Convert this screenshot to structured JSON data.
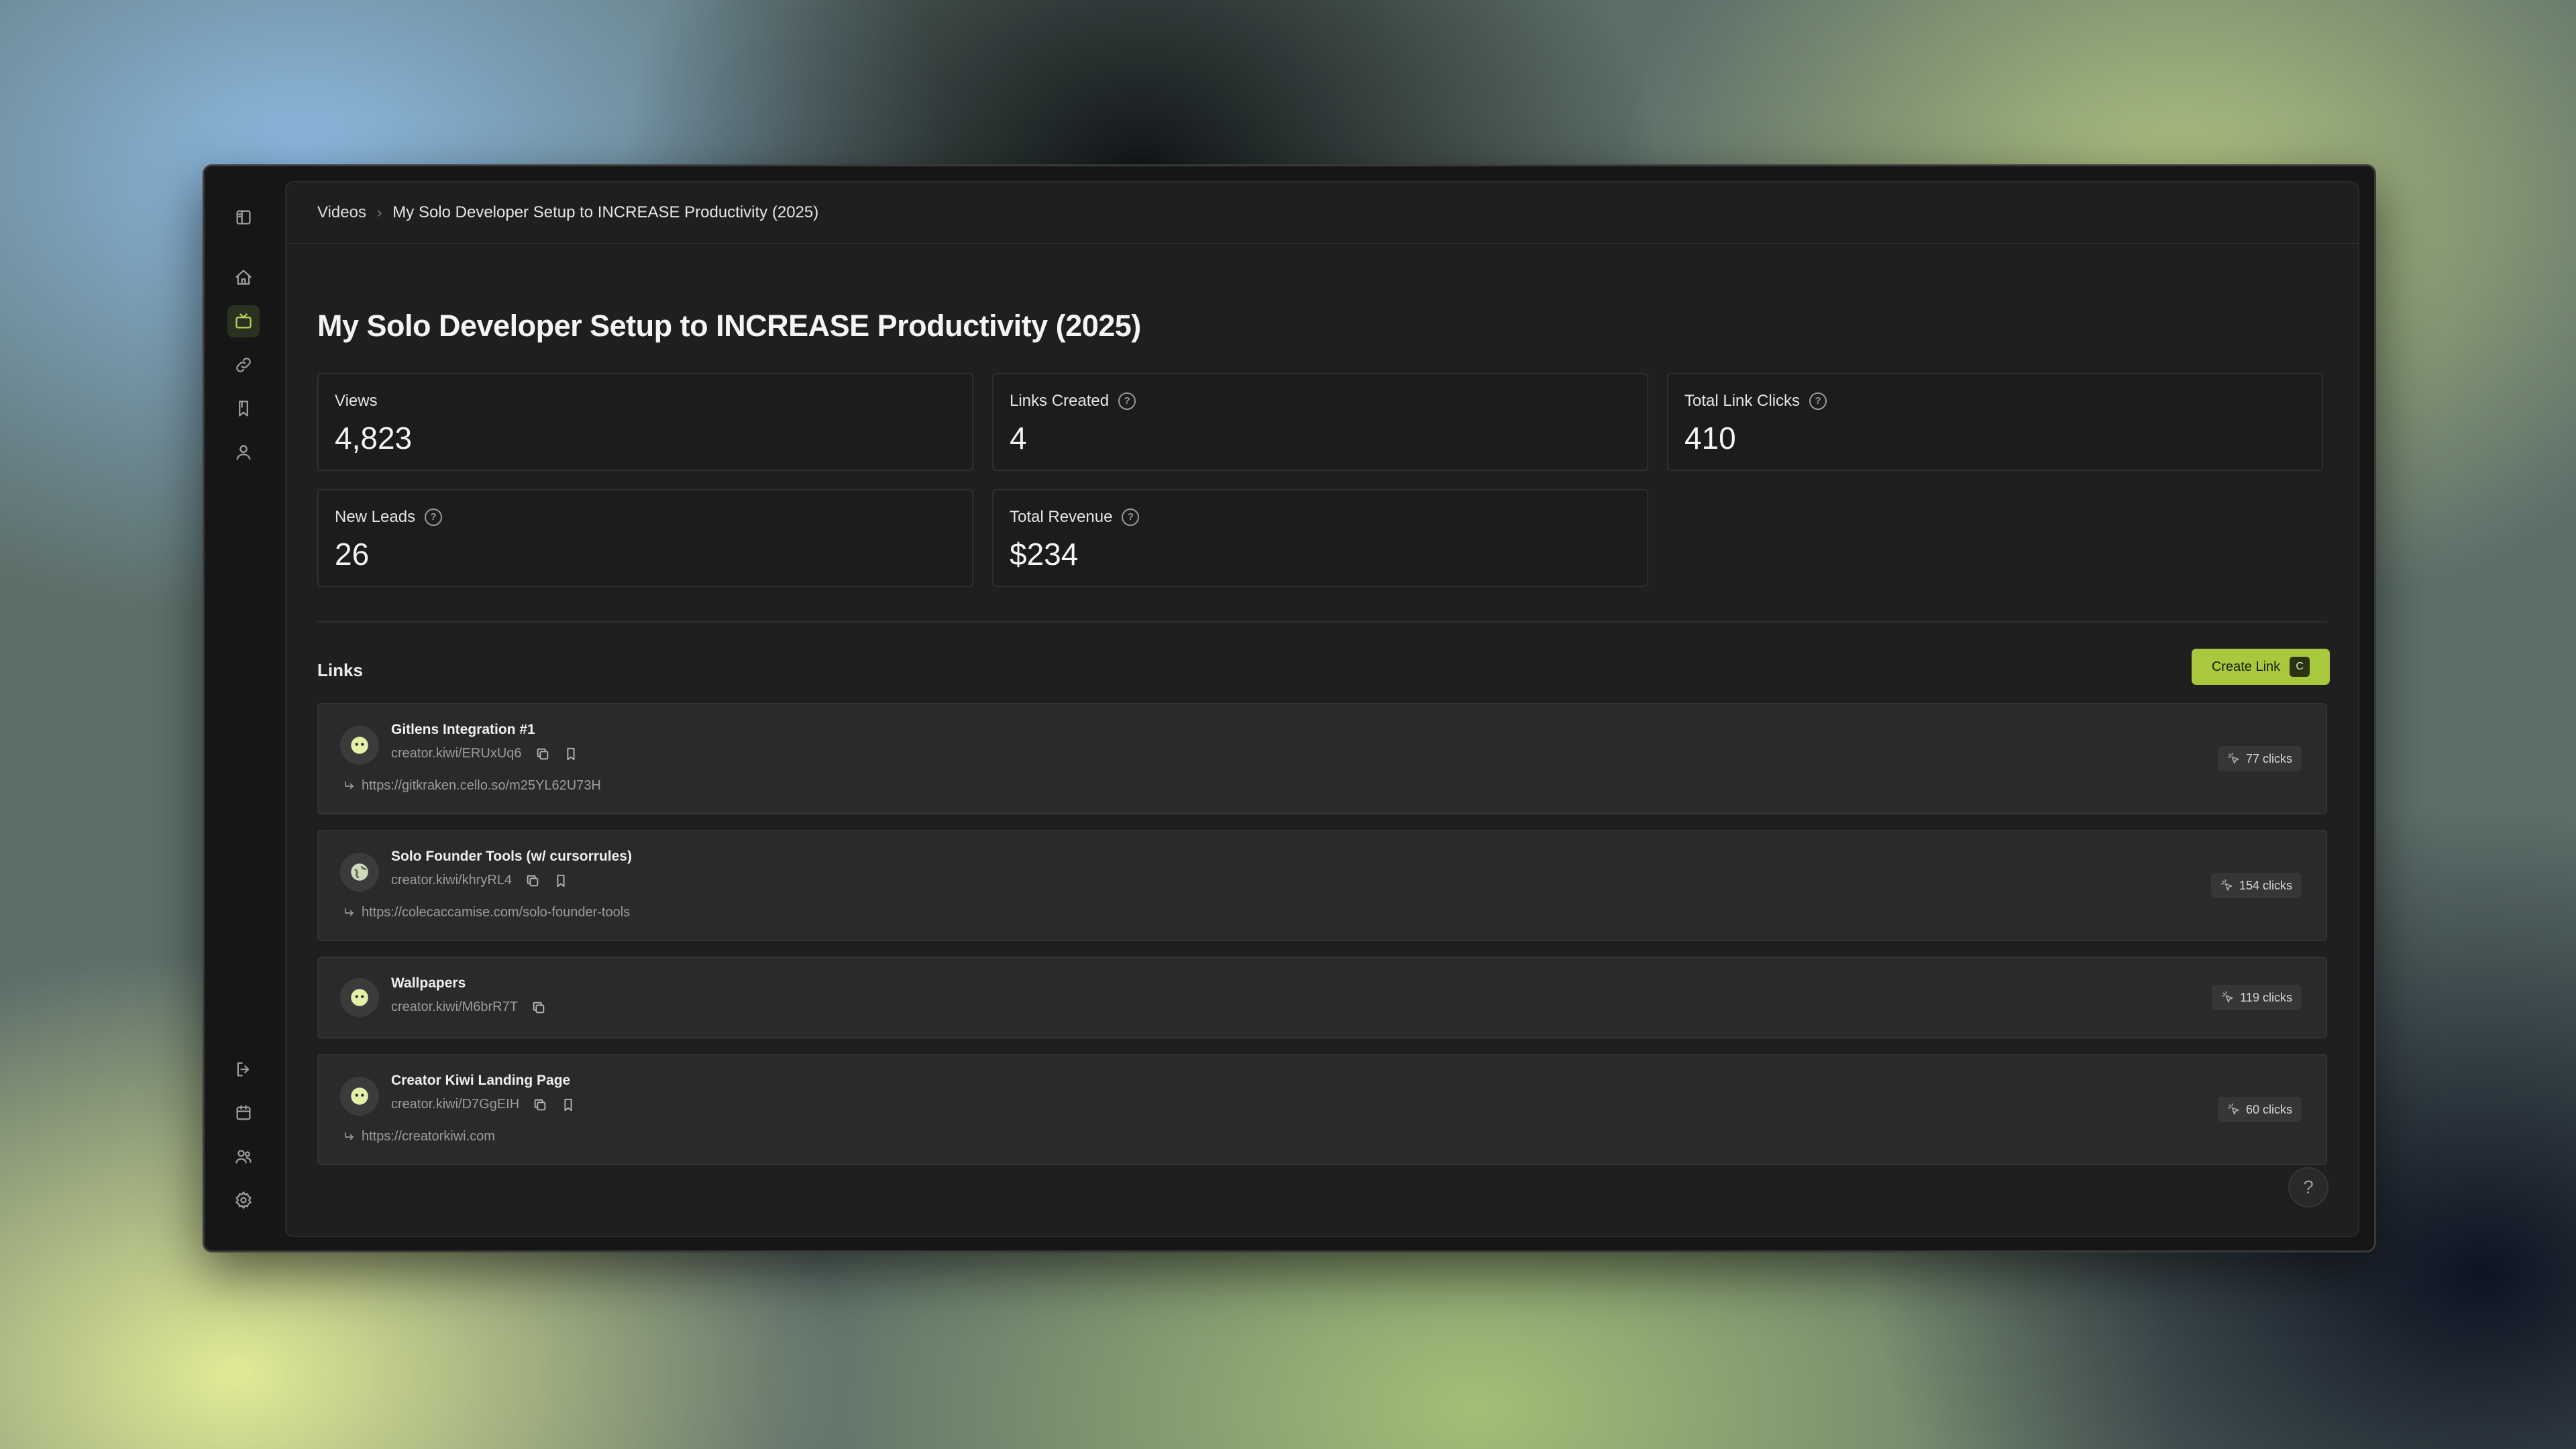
{
  "breadcrumb": {
    "parent": "Videos",
    "current": "My Solo Developer Setup to INCREASE Productivity (2025)"
  },
  "page": {
    "title": "My Solo Developer Setup to INCREASE Productivity (2025)"
  },
  "stats": [
    {
      "label": "Views",
      "value": "4,823",
      "has_help": false
    },
    {
      "label": "Links Created",
      "value": "4",
      "has_help": true
    },
    {
      "label": "Total Link Clicks",
      "value": "410",
      "has_help": true
    },
    {
      "label": "New Leads",
      "value": "26",
      "has_help": true
    },
    {
      "label": "Total Revenue",
      "value": "$234",
      "has_help": true
    }
  ],
  "links_section": {
    "title": "Links",
    "create_button": "Create Link",
    "create_shortcut": "C"
  },
  "links": [
    {
      "name": "Gitlens Integration #1",
      "short": "creator.kiwi/ERUxUq6",
      "dest": "https://gitkraken.cello.so/m25YL62U73H",
      "clicks": "77 clicks"
    },
    {
      "name": "Solo Founder Tools (w/ cursorrules)",
      "short": "creator.kiwi/khryRL4",
      "dest": "https://colecaccamise.com/solo-founder-tools",
      "clicks": "154 clicks"
    },
    {
      "name": "Wallpapers",
      "short": "creator.kiwi/M6brR7T",
      "dest": "",
      "clicks": "119 clicks"
    },
    {
      "name": "Creator Kiwi Landing Page",
      "short": "creator.kiwi/D7GgEIH",
      "dest": "https://creatorkiwi.com",
      "clicks": "60 clicks"
    }
  ],
  "help_fab": "?",
  "colors": {
    "accent": "#a8c93e",
    "background": "#161616",
    "panel": "#1f1f1f",
    "card": "#2a2a2a"
  },
  "icons": {
    "rail_top": [
      "sidebar-toggle-icon",
      "home-icon",
      "tv-icon",
      "link-icon",
      "bookmark-icon",
      "user-icon"
    ],
    "rail_bottom": [
      "logout-icon",
      "calendar-icon",
      "users-icon",
      "settings-icon"
    ]
  }
}
